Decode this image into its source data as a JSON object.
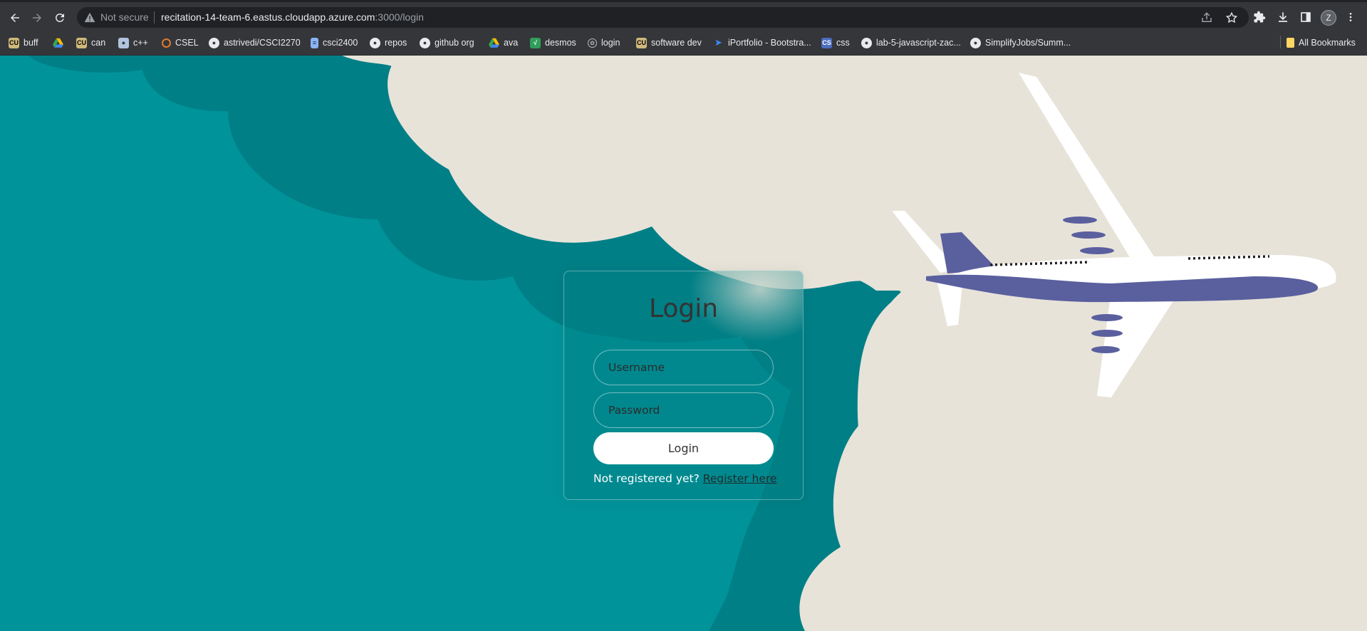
{
  "browser": {
    "security_label": "Not secure",
    "url_host": "recitation-14-team-6.eastus.cloudapp.azure.com",
    "url_path": ":3000/login",
    "profile_initial": "Z",
    "icons": [
      "back-icon",
      "forward-icon",
      "reload-icon",
      "warning-icon",
      "share-icon",
      "star-icon",
      "extensions-icon",
      "download-icon",
      "sidepanel-icon",
      "menu-icon"
    ]
  },
  "bookmarks": [
    {
      "label": "buff",
      "icon": "cu-icon"
    },
    {
      "label": "",
      "icon": "drive-icon"
    },
    {
      "label": "can",
      "icon": "cu-icon"
    },
    {
      "label": "c++",
      "icon": "people-icon"
    },
    {
      "label": "CSEL",
      "icon": "ring-icon"
    },
    {
      "label": "astrivedi/CSCI2270",
      "icon": "github-icon"
    },
    {
      "label": "csci2400",
      "icon": "doc-icon"
    },
    {
      "label": "repos",
      "icon": "github-icon"
    },
    {
      "label": "github org",
      "icon": "github-icon"
    },
    {
      "label": "ava",
      "icon": "drive-icon"
    },
    {
      "label": "desmos",
      "icon": "desmos-icon"
    },
    {
      "label": "login",
      "icon": "chatgpt-icon"
    },
    {
      "label": "software dev",
      "icon": "cu-icon"
    },
    {
      "label": "iPortfolio - Bootstra...",
      "icon": "bootstrap-icon"
    },
    {
      "label": "css",
      "icon": "css-icon"
    },
    {
      "label": "lab-5-javascript-zac...",
      "icon": "github-icon"
    },
    {
      "label": "SimplifyJobs/Summ...",
      "icon": "github-icon"
    }
  ],
  "all_bookmarks_label": "All Bookmarks",
  "login": {
    "title": "Login",
    "username_placeholder": "Username",
    "password_placeholder": "Password",
    "button_label": "Login",
    "register_prompt": "Not registered yet?",
    "register_link": "Register here"
  },
  "colors": {
    "teal_dark": "#007f86",
    "teal_light": "#00939a",
    "cream": "#e7e3d9",
    "plane_body": "#5a5f9e",
    "chrome_bg": "#35363a"
  }
}
